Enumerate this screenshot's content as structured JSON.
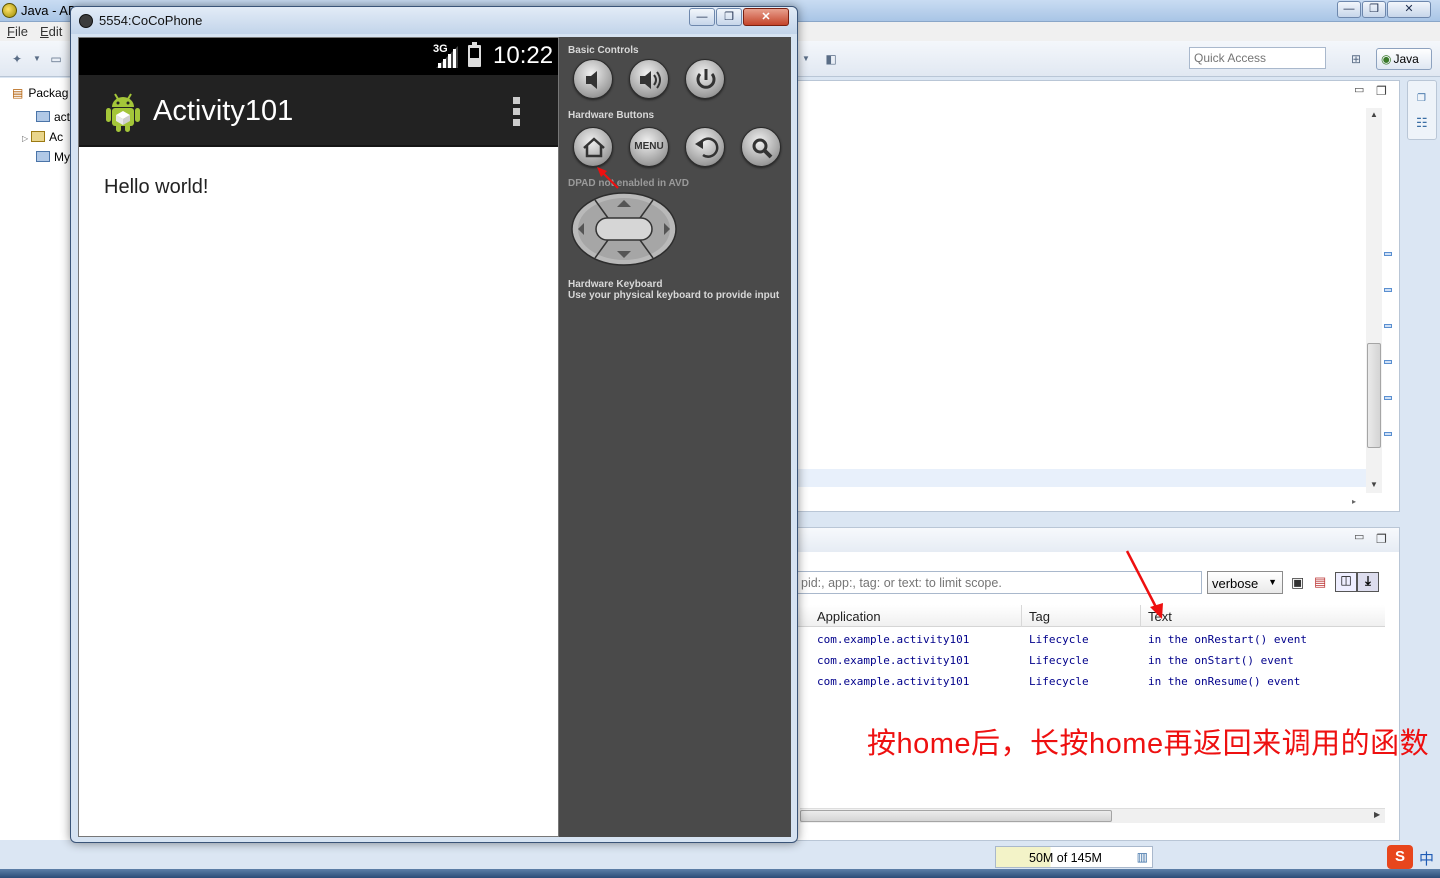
{
  "eclipse": {
    "title": "Java - AD",
    "menu": [
      "File",
      "Edit"
    ],
    "quick_access_placeholder": "Quick Access",
    "perspective": "Java",
    "tree": [
      "Packag",
      "act",
      "Ac",
      "My"
    ],
    "heap": "50M of 145M",
    "ime_logo": "S",
    "ime_mode": "中"
  },
  "logcat": {
    "filter_placeholder": "pid:, app:, tag: or text: to limit scope.",
    "level": "verbose",
    "columns": [
      "Application",
      "Tag",
      "Text"
    ],
    "rows": [
      {
        "app": "com.example.activity101",
        "tag": "Lifecycle",
        "text": "in the onRestart() event"
      },
      {
        "app": "com.example.activity101",
        "tag": "Lifecycle",
        "text": "in the onStart() event"
      },
      {
        "app": "com.example.activity101",
        "tag": "Lifecycle",
        "text": "in the onResume() event"
      }
    ]
  },
  "annotation": "按home后，长按home再返回来调用的函数",
  "emulator": {
    "title": "5554:CoCoPhone",
    "network": "3G",
    "time": "10:22",
    "app_title": "Activity101",
    "content_text": "Hello world!",
    "sections": {
      "basic_controls": "Basic Controls",
      "hardware_buttons": "Hardware Buttons",
      "dpad": "DPAD not enabled in AVD",
      "keyboard_title": "Hardware Keyboard",
      "keyboard_sub": "Use your physical keyboard to provide input"
    },
    "menu_button": "MENU"
  },
  "colors": {
    "annotation": "#ee1010",
    "log_text": "#00008b",
    "actionbar": "#222222",
    "controls_panel": "#4a4a4a"
  }
}
